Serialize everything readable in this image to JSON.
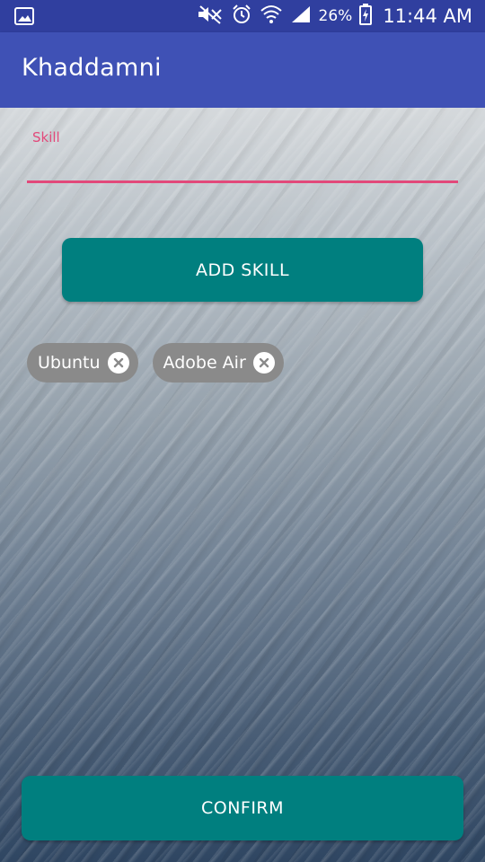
{
  "status_bar": {
    "battery_percent": "26%",
    "time": "11:44 AM",
    "icons": [
      "gallery-icon",
      "mute-icon",
      "alarm-icon",
      "wifi-icon",
      "signal-icon",
      "battery-charging-icon"
    ]
  },
  "app_bar": {
    "title": "Khaddamni"
  },
  "form": {
    "skill_label": "Skill",
    "skill_value": "",
    "add_skill_label": "ADD SKILL"
  },
  "chips": [
    {
      "label": "Ubuntu"
    },
    {
      "label": "Adobe Air"
    }
  ],
  "confirm_label": "CONFIRM",
  "colors": {
    "status_bar": "#303f9f",
    "app_bar": "#3f51b5",
    "accent": "#e2497a",
    "button": "#007f7f",
    "chip": "#8a8a8a"
  }
}
